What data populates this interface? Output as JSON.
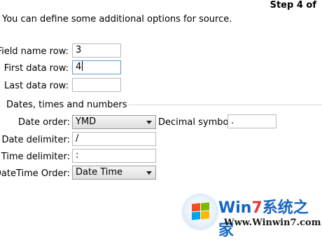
{
  "header": {
    "step": "Step 4 of",
    "description": "You can define some additional options for source."
  },
  "rows": {
    "field_name_row": {
      "label": "Field name row:",
      "value": "3"
    },
    "first_data_row": {
      "label": "First data row:",
      "value": "4"
    },
    "last_data_row": {
      "label": "Last data row:",
      "value": ""
    }
  },
  "dates_group": {
    "title": "Dates, times and numbers",
    "date_order": {
      "label": "Date order:",
      "value": "YMD"
    },
    "decimal_symbol": {
      "label": "Decimal symbol:",
      "value": "."
    },
    "date_delimiter": {
      "label": "Date delimiter:",
      "value": "/"
    },
    "time_delimiter": {
      "label": "Time delimiter:",
      "value": ":"
    },
    "datetime_order": {
      "label": "DateTime Order:",
      "value": "Date Time"
    }
  },
  "watermark": {
    "brand_win": "Win",
    "brand_7": "7",
    "brand_cn": "系统之家",
    "url": "Www.Winwin7.com"
  },
  "colors": {
    "focus_border": "#5b9bd5",
    "watermark_blue": "#1565c0",
    "watermark_red": "#e53935"
  }
}
